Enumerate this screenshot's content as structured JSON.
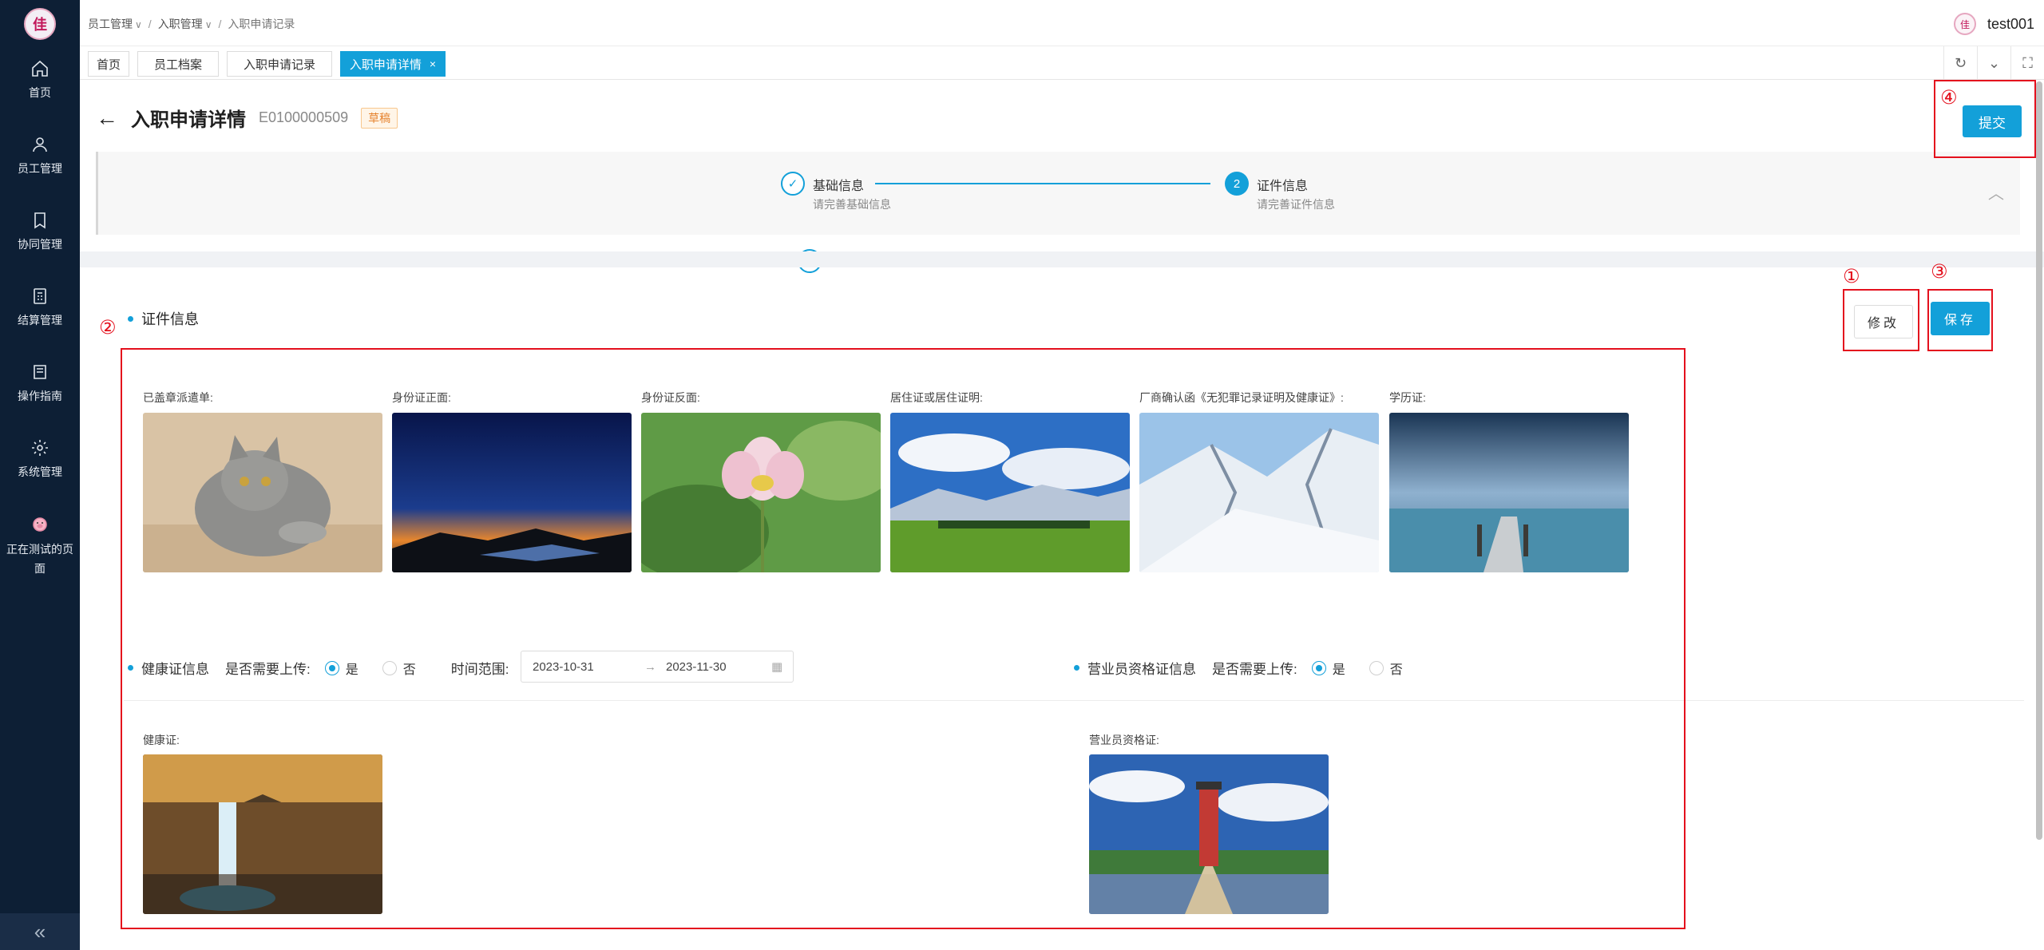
{
  "sidebar": {
    "logo": "佳",
    "items": [
      {
        "label": "首页",
        "icon": "home-icon"
      },
      {
        "label": "员工管理",
        "icon": "user-icon"
      },
      {
        "label": "协同管理",
        "icon": "bookmark-icon"
      },
      {
        "label": "结算管理",
        "icon": "calculator-icon"
      },
      {
        "label": "操作指南",
        "icon": "book-icon"
      },
      {
        "label": "系统管理",
        "icon": "gear-icon"
      },
      {
        "label": "正在测试的页面",
        "icon": "pig-icon"
      }
    ],
    "collapse": "«"
  },
  "header": {
    "breadcrumbs": [
      "员工管理",
      "入职管理",
      "入职申请记录"
    ],
    "username": "test001"
  },
  "tabs": [
    {
      "label": "首页"
    },
    {
      "label": "员工档案"
    },
    {
      "label": "入职申请记录"
    },
    {
      "label": "入职申请详情",
      "close": "×"
    }
  ],
  "page": {
    "title": "入职申请详情",
    "code": "E0100000509",
    "status": "草稿",
    "submit": "提交"
  },
  "steps": [
    {
      "index": "✓",
      "title": "基础信息",
      "desc": "请完善基础信息"
    },
    {
      "index": "2",
      "title": "证件信息",
      "desc": "请完善证件信息"
    }
  ],
  "section": {
    "title": "证件信息",
    "edit": "修改",
    "save": "保存"
  },
  "documents": [
    {
      "label": "已盖章派遣单:",
      "image": "cat"
    },
    {
      "label": "身份证正面:",
      "image": "night-sky"
    },
    {
      "label": "身份证反面:",
      "image": "lotus"
    },
    {
      "label": "居住证或居住证明:",
      "image": "meadow"
    },
    {
      "label": "厂商确认函《无犯罪记录证明及健康证》:",
      "image": "snow-mountain"
    },
    {
      "label": "学历证:",
      "image": "pier"
    }
  ],
  "health": {
    "title": "健康证信息",
    "need_upload": "是否需要上传:",
    "yes": "是",
    "no": "否",
    "range_label": "时间范围:",
    "start": "2023-10-31",
    "arrow": "→",
    "end": "2023-11-30",
    "doc_label": "健康证:"
  },
  "sales": {
    "title": "营业员资格证信息",
    "need_upload": "是否需要上传:",
    "yes": "是",
    "no": "否",
    "doc_label": "营业员资格证:"
  },
  "annotations": [
    "①",
    "②",
    "③",
    "④"
  ]
}
